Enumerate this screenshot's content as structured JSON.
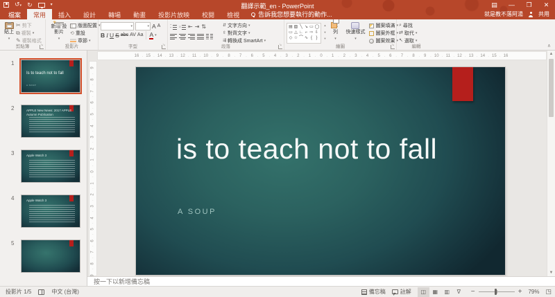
{
  "titlebar": {
    "title": "翻譯示範_en - PowerPoint",
    "user": "就是教不落阿湯",
    "share_label": "共用"
  },
  "tabs": {
    "file_label": "檔案",
    "labels": [
      "常用",
      "插入",
      "設計",
      "轉場",
      "動畫",
      "投影片放映",
      "校閱",
      "檢視"
    ],
    "active": "常用",
    "tell_me": "告訴我您想要執行的動作..."
  },
  "ribbon": {
    "clipboard": {
      "group_label": "剪貼簿",
      "paste_label": "貼上",
      "cut_label": "剪下",
      "copy_label": "複製",
      "format_painter_label": "複製格式"
    },
    "slides": {
      "group_label": "投影片",
      "new_slide_label": "新增 投影片",
      "layout_label": "版面配置",
      "reset_label": "重設",
      "section_label": "章節"
    },
    "font": {
      "group_label": "字型",
      "bold": "B",
      "italic": "I",
      "underline": "U",
      "strike": "S",
      "strike_abc": "abc",
      "spacing": "AV",
      "case": "Aa",
      "color": "A",
      "grow": "A",
      "shrink": "A"
    },
    "paragraph": {
      "group_label": "段落",
      "text_direction_label": "文字方向",
      "align_text_label": "對齊文字",
      "smartart_label": "轉換成 SmartArt"
    },
    "drawing": {
      "group_label": "繪圖",
      "arrange_label": "排列",
      "quick_styles_label": "快速樣式",
      "shape_fill_label": "圖案填滿",
      "shape_outline_label": "圖案外框",
      "shape_effects_label": "圖案效果",
      "shapes_rows": [
        [
          "▤",
          "▧",
          "╲",
          "↘",
          "▭",
          "◯"
        ],
        [
          "▭",
          "△",
          "∟",
          "⌐",
          "⇨",
          "⇩"
        ],
        [
          "◇",
          "☆",
          "⌒",
          "∿",
          "{",
          "}"
        ]
      ]
    },
    "editing": {
      "group_label": "編輯",
      "find_label": "尋找",
      "replace_label": "取代",
      "select_label": "選取"
    }
  },
  "thumbnails": {
    "items": [
      {
        "num": "1",
        "selected": true,
        "kind": "title",
        "title": "Is to teach not to fall",
        "subtitle": "A SOUP"
      },
      {
        "num": "2",
        "selected": false,
        "kind": "content",
        "title": "APPLE New News: 2017 APPLE Autumn Publication"
      },
      {
        "num": "3",
        "selected": false,
        "kind": "content",
        "title": "Apple Watch 3"
      },
      {
        "num": "4",
        "selected": false,
        "kind": "content",
        "title": "Apple Watch 3"
      },
      {
        "num": "5",
        "selected": false,
        "kind": "empty",
        "title": ""
      }
    ]
  },
  "slide": {
    "title": "is to teach not to fall",
    "subtitle": "A SOUP"
  },
  "rulers": {
    "h_max": 16,
    "v_max": 9
  },
  "notes": {
    "placeholder": "按一下以新增備忘稿"
  },
  "statusbar": {
    "slide_info": "投影片 1/5",
    "language": "中文 (台灣)",
    "notes_label": "備忘稿",
    "comments_label": "註解",
    "zoom_value": "79%"
  },
  "colors": {
    "titlebar": "#b7472a",
    "accent_red": "#b51f1c",
    "slide_subtitle": "#9fc3bf"
  }
}
